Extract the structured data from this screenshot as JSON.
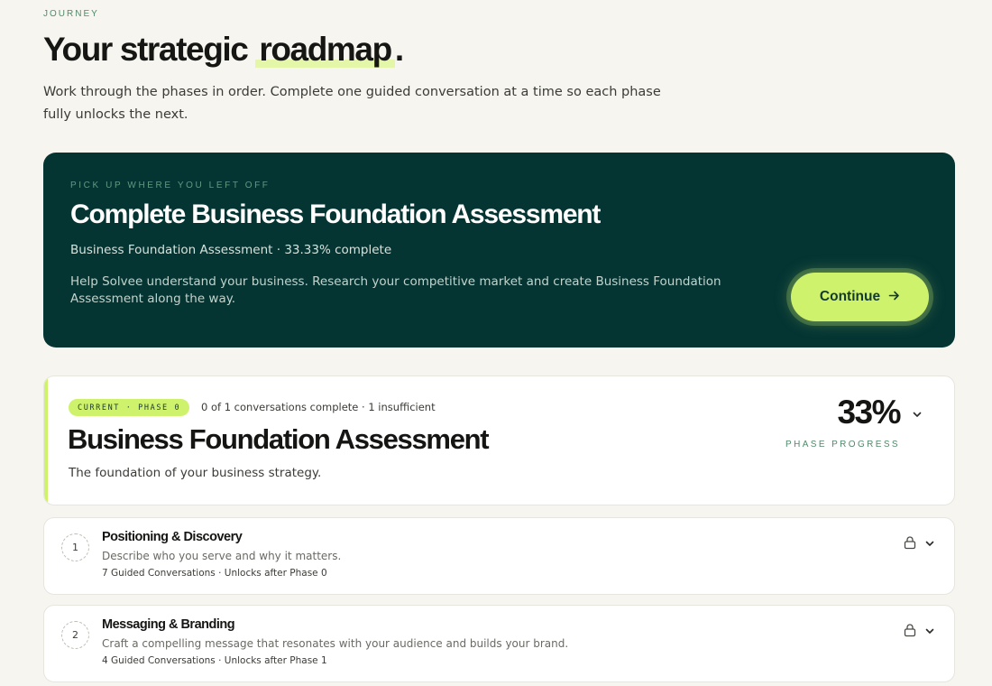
{
  "header": {
    "eyebrow": "JOURNEY",
    "title_prefix": "Your strategic",
    "title_highlight": "roadmap",
    "title_suffix": ".",
    "subtitle": "Work through the phases in order. Complete one guided conversation at a time so each phase fully unlocks the next."
  },
  "hero": {
    "eyebrow": "PICK UP WHERE YOU LEFT OFF",
    "title": "Complete Business Foundation Assessment",
    "meta": "Business Foundation Assessment · 33.33% complete",
    "description": "Help Solvee understand your business. Research your competitive market and create Business Foundation Assessment along the way.",
    "button_label": "Continue",
    "button_icon": "arrow-right-icon",
    "background_color": "#053533",
    "button_color": "#cff26c"
  },
  "current_phase": {
    "badge": "CURRENT · PHASE 0",
    "stats": "0 of 1 conversations complete · 1 insufficient",
    "title": "Business Foundation Assessment",
    "description": "The foundation of your business strategy.",
    "progress_value": "33%",
    "progress_label": "PHASE PROGRESS",
    "chevron_icon": "chevron-down-icon",
    "accent_color": "#cff26c"
  },
  "phases": [
    {
      "number": "1",
      "title": "Positioning & Discovery",
      "description": "Describe who you serve and why it matters.",
      "meta": "7 Guided Conversations · Unlocks after Phase 0",
      "status_icon": "lock-icon"
    },
    {
      "number": "2",
      "title": "Messaging & Branding",
      "description": "Craft a compelling message that resonates with your audience and builds your brand.",
      "meta": "4 Guided Conversations · Unlocks after Phase 1",
      "status_icon": "lock-icon"
    }
  ]
}
